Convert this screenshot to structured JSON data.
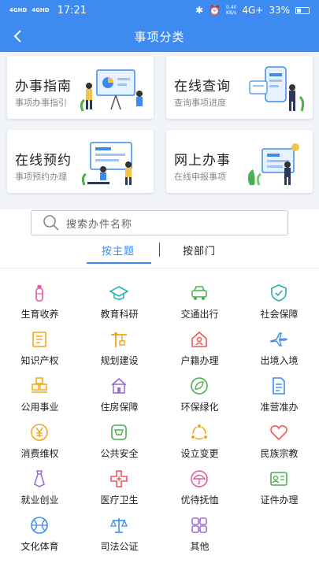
{
  "status_bar": {
    "network_1": "4GHD",
    "network_2": "4GHD",
    "time": "17:21",
    "speed_value": "0.40",
    "speed_unit": "KB/s",
    "signal": "4G+",
    "battery": "33%"
  },
  "navbar": {
    "title": "事项分类"
  },
  "cards": [
    {
      "title": "办事指南",
      "subtitle": "事项办事指引"
    },
    {
      "title": "在线查询",
      "subtitle": "查询事项进度"
    },
    {
      "title": "在线预约",
      "subtitle": "事项预约办理"
    },
    {
      "title": "网上办事",
      "subtitle": "在线申报事项"
    }
  ],
  "search": {
    "placeholder": "搜索办件名称"
  },
  "tabs": [
    {
      "label": "按主题"
    },
    {
      "label": "按部门"
    }
  ],
  "categories": [
    {
      "label": "生育收养",
      "icon": "baby-bottle-icon",
      "color": "#e85aa0"
    },
    {
      "label": "教育科研",
      "icon": "graduation-cap-icon",
      "color": "#25b6b0"
    },
    {
      "label": "交通出行",
      "icon": "car-icon",
      "color": "#4caf50"
    },
    {
      "label": "社会保障",
      "icon": "shield-icon",
      "color": "#1fb3a8"
    },
    {
      "label": "知识产权",
      "icon": "certificate-icon",
      "color": "#f2a516"
    },
    {
      "label": "规划建设",
      "icon": "construction-icon",
      "color": "#f2a516"
    },
    {
      "label": "户籍办理",
      "icon": "house-user-icon",
      "color": "#f25555"
    },
    {
      "label": "出境入境",
      "icon": "airplane-icon",
      "color": "#3d8bf0"
    },
    {
      "label": "公用事业",
      "icon": "boxes-icon",
      "color": "#f2a516"
    },
    {
      "label": "住房保障",
      "icon": "house-icon",
      "color": "#9a6fd8"
    },
    {
      "label": "环保绿化",
      "icon": "leaf-icon",
      "color": "#4caf50"
    },
    {
      "label": "准营准办",
      "icon": "document-icon",
      "color": "#3d8bf0"
    },
    {
      "label": "消费维权",
      "icon": "yen-coin-icon",
      "color": "#f2a516"
    },
    {
      "label": "公共安全",
      "icon": "security-badge-icon",
      "color": "#4caf50"
    },
    {
      "label": "设立变更",
      "icon": "cycle-icon",
      "color": "#f2a516"
    },
    {
      "label": "民族宗教",
      "icon": "heart-icon",
      "color": "#f25555"
    },
    {
      "label": "就业创业",
      "icon": "tie-icon",
      "color": "#9a6fd8"
    },
    {
      "label": "医疗卫生",
      "icon": "medical-cross-icon",
      "color": "#f25555"
    },
    {
      "label": "优待抚恤",
      "icon": "umbrella-icon",
      "color": "#e85aa0"
    },
    {
      "label": "证件办理",
      "icon": "id-card-icon",
      "color": "#4caf50"
    },
    {
      "label": "文化体育",
      "icon": "ball-icon",
      "color": "#3d8bf0"
    },
    {
      "label": "司法公证",
      "icon": "scales-icon",
      "color": "#3d8bf0"
    },
    {
      "label": "其他",
      "icon": "grid-icon",
      "color": "#9a6fd8"
    }
  ],
  "colors": {
    "primary": "#3d8bf0"
  }
}
